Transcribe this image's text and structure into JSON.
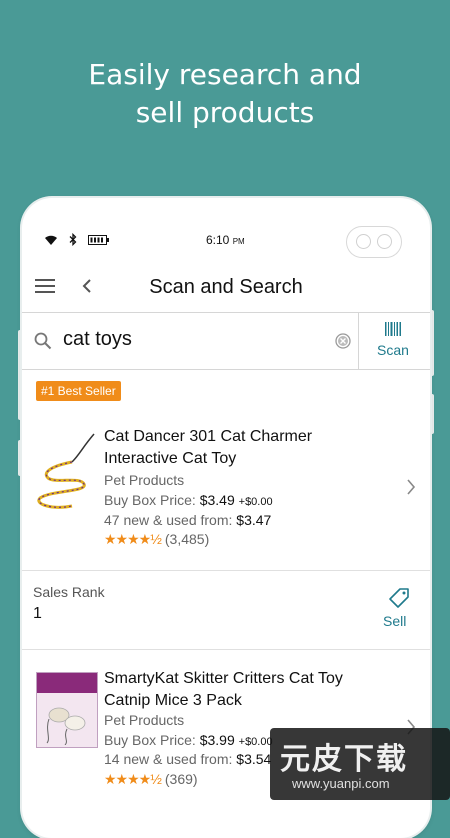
{
  "headline": {
    "line1": "Easily research and",
    "line2": "sell products"
  },
  "status_bar": {
    "time": "6:10",
    "ampm": "PM"
  },
  "topbar": {
    "title": "Scan and Search"
  },
  "search": {
    "query": "cat toys",
    "scan_label": "Scan"
  },
  "badge": {
    "label": "#1 Best Seller"
  },
  "products": [
    {
      "title_line1": "Cat Dancer 301 Cat Charmer",
      "title_line2": "Interactive Cat Toy",
      "category": "Pet Products",
      "buybox_label": "Buy Box Price: ",
      "buybox_price": "$3.49",
      "buybox_shipping": "+$0.00",
      "offers_label": "47 new & used from: ",
      "offers_price": "$3.47",
      "rating_stars": "★★★★½",
      "rating_value": 4.5,
      "reviews": "(3,485)"
    },
    {
      "title_line1": "SmartyKat Skitter Critters Cat Toy",
      "title_line2": "Catnip Mice 3 Pack",
      "category": "Pet Products",
      "buybox_label": "Buy Box Price: ",
      "buybox_price": "$3.99",
      "buybox_shipping": "+$0.00",
      "offers_label": "14 new & used from: ",
      "offers_price": "$3.54",
      "rating_stars": "★★★★½",
      "rating_value": 4.5,
      "reviews": "(369)"
    }
  ],
  "sales_rank": {
    "label": "Sales Rank",
    "value": "1",
    "sell_label": "Sell"
  },
  "watermark": {
    "text": "元皮下载",
    "url": "www.yuanpi.com"
  },
  "colors": {
    "background": "#4a9a96",
    "accent": "#1f7a8c",
    "badge": "#f08c1a",
    "stars": "#f08c1a"
  },
  "icons": [
    "wifi-icon",
    "bluetooth-icon",
    "battery-icon",
    "menu-icon",
    "back-icon",
    "search-icon",
    "clear-icon",
    "barcode-icon",
    "chevron-right-icon",
    "tag-icon"
  ]
}
